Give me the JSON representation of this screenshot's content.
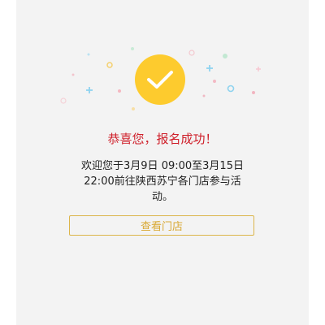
{
  "success": {
    "title": "恭喜您，报名成功！",
    "message": "欢迎您于3月9日 09:00至3月15日 22:00前往陕西苏宁各门店参与活动。"
  },
  "actions": {
    "view_store_label": "查看门店"
  },
  "colors": {
    "accent": "#fdcb2e",
    "title": "#cf1f2a",
    "button_text": "#d9a935",
    "background": "#f3f3f3"
  },
  "icons": {
    "status": "checkmark-icon"
  }
}
